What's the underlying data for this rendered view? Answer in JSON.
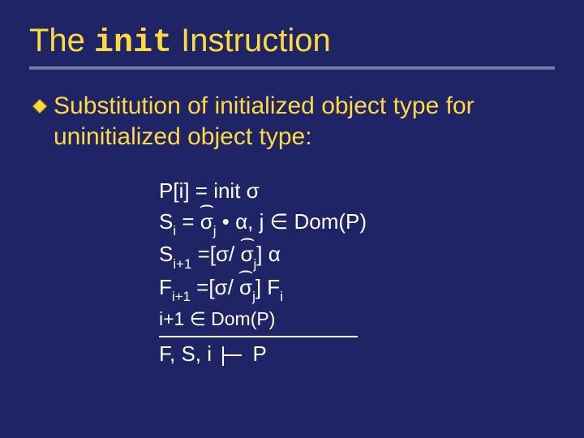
{
  "title": {
    "pre": "The ",
    "code": "init",
    "post": " Instruction"
  },
  "bullet": {
    "text": "Substitution of initialized object type for uninitialized object type:"
  },
  "math": {
    "l1_a": "P[i] = init σ",
    "l2_a": "S",
    "l2_sub1": "i",
    "l2_b": " = ",
    "l2_hat1": "σ",
    "l2_hatsub1": "j",
    "l2_c": " • α,  j ∈ Dom(P)",
    "l3_a": "S",
    "l3_sub1": "i+1",
    "l3_b": " =[σ/ ",
    "l3_hat1": "σ",
    "l3_hatsub1": "j",
    "l3_c": "] α",
    "l4_a": "F",
    "l4_sub1": "i+1",
    "l4_b": " =[σ/ ",
    "l4_hat1": "σ",
    "l4_hatsub1": "j",
    "l4_c": "] F",
    "l4_sub2": "i",
    "l5_a": "i+1 ∈ Dom(P)",
    "l6_a": "F, S, i ",
    "l6_b": "  P"
  }
}
